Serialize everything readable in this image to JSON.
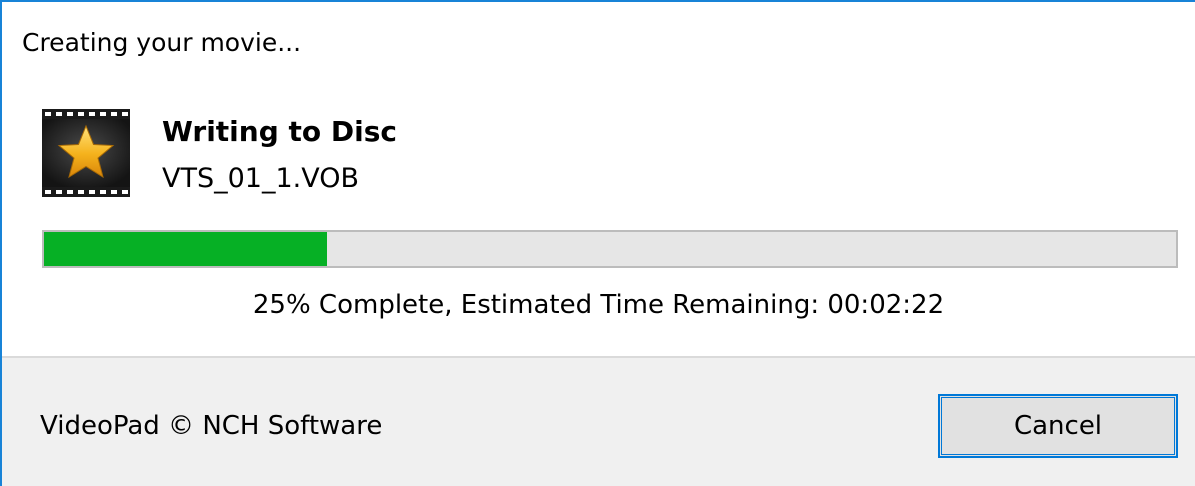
{
  "dialog": {
    "title": "Creating your movie..."
  },
  "operation": {
    "title": "Writing to Disc",
    "file": "VTS_01_1.VOB",
    "icon": "videopad-film-star-icon"
  },
  "progress": {
    "percent": 25,
    "status_text": "25% Complete, Estimated Time Remaining: 00:02:22",
    "fill_color": "#06b025"
  },
  "footer": {
    "copyright": "VideoPad © NCH Software",
    "cancel_label": "Cancel"
  },
  "colors": {
    "accent": "#0078d7",
    "window_border": "#1883d7",
    "footer_background": "#f0f0f0"
  }
}
